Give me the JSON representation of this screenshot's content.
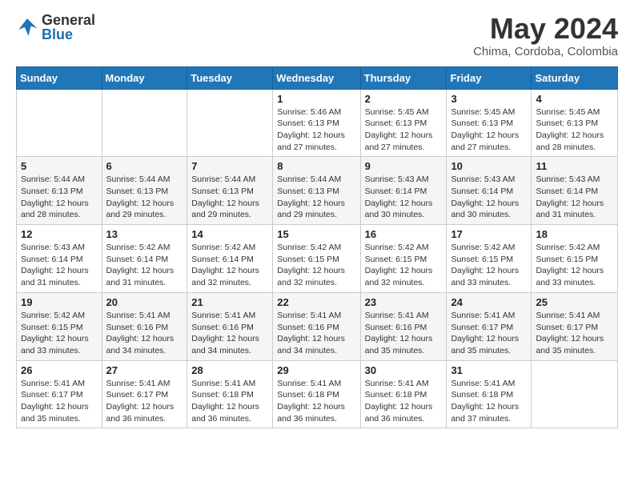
{
  "header": {
    "logo_general": "General",
    "logo_blue": "Blue",
    "month_title": "May 2024",
    "location": "Chima, Cordoba, Colombia"
  },
  "calendar": {
    "days_of_week": [
      "Sunday",
      "Monday",
      "Tuesday",
      "Wednesday",
      "Thursday",
      "Friday",
      "Saturday"
    ],
    "weeks": [
      [
        {
          "day": "",
          "info": ""
        },
        {
          "day": "",
          "info": ""
        },
        {
          "day": "",
          "info": ""
        },
        {
          "day": "1",
          "info": "Sunrise: 5:46 AM\nSunset: 6:13 PM\nDaylight: 12 hours and 27 minutes."
        },
        {
          "day": "2",
          "info": "Sunrise: 5:45 AM\nSunset: 6:13 PM\nDaylight: 12 hours and 27 minutes."
        },
        {
          "day": "3",
          "info": "Sunrise: 5:45 AM\nSunset: 6:13 PM\nDaylight: 12 hours and 27 minutes."
        },
        {
          "day": "4",
          "info": "Sunrise: 5:45 AM\nSunset: 6:13 PM\nDaylight: 12 hours and 28 minutes."
        }
      ],
      [
        {
          "day": "5",
          "info": "Sunrise: 5:44 AM\nSunset: 6:13 PM\nDaylight: 12 hours and 28 minutes."
        },
        {
          "day": "6",
          "info": "Sunrise: 5:44 AM\nSunset: 6:13 PM\nDaylight: 12 hours and 29 minutes."
        },
        {
          "day": "7",
          "info": "Sunrise: 5:44 AM\nSunset: 6:13 PM\nDaylight: 12 hours and 29 minutes."
        },
        {
          "day": "8",
          "info": "Sunrise: 5:44 AM\nSunset: 6:13 PM\nDaylight: 12 hours and 29 minutes."
        },
        {
          "day": "9",
          "info": "Sunrise: 5:43 AM\nSunset: 6:14 PM\nDaylight: 12 hours and 30 minutes."
        },
        {
          "day": "10",
          "info": "Sunrise: 5:43 AM\nSunset: 6:14 PM\nDaylight: 12 hours and 30 minutes."
        },
        {
          "day": "11",
          "info": "Sunrise: 5:43 AM\nSunset: 6:14 PM\nDaylight: 12 hours and 31 minutes."
        }
      ],
      [
        {
          "day": "12",
          "info": "Sunrise: 5:43 AM\nSunset: 6:14 PM\nDaylight: 12 hours and 31 minutes."
        },
        {
          "day": "13",
          "info": "Sunrise: 5:42 AM\nSunset: 6:14 PM\nDaylight: 12 hours and 31 minutes."
        },
        {
          "day": "14",
          "info": "Sunrise: 5:42 AM\nSunset: 6:14 PM\nDaylight: 12 hours and 32 minutes."
        },
        {
          "day": "15",
          "info": "Sunrise: 5:42 AM\nSunset: 6:15 PM\nDaylight: 12 hours and 32 minutes."
        },
        {
          "day": "16",
          "info": "Sunrise: 5:42 AM\nSunset: 6:15 PM\nDaylight: 12 hours and 32 minutes."
        },
        {
          "day": "17",
          "info": "Sunrise: 5:42 AM\nSunset: 6:15 PM\nDaylight: 12 hours and 33 minutes."
        },
        {
          "day": "18",
          "info": "Sunrise: 5:42 AM\nSunset: 6:15 PM\nDaylight: 12 hours and 33 minutes."
        }
      ],
      [
        {
          "day": "19",
          "info": "Sunrise: 5:42 AM\nSunset: 6:15 PM\nDaylight: 12 hours and 33 minutes."
        },
        {
          "day": "20",
          "info": "Sunrise: 5:41 AM\nSunset: 6:16 PM\nDaylight: 12 hours and 34 minutes."
        },
        {
          "day": "21",
          "info": "Sunrise: 5:41 AM\nSunset: 6:16 PM\nDaylight: 12 hours and 34 minutes."
        },
        {
          "day": "22",
          "info": "Sunrise: 5:41 AM\nSunset: 6:16 PM\nDaylight: 12 hours and 34 minutes."
        },
        {
          "day": "23",
          "info": "Sunrise: 5:41 AM\nSunset: 6:16 PM\nDaylight: 12 hours and 35 minutes."
        },
        {
          "day": "24",
          "info": "Sunrise: 5:41 AM\nSunset: 6:17 PM\nDaylight: 12 hours and 35 minutes."
        },
        {
          "day": "25",
          "info": "Sunrise: 5:41 AM\nSunset: 6:17 PM\nDaylight: 12 hours and 35 minutes."
        }
      ],
      [
        {
          "day": "26",
          "info": "Sunrise: 5:41 AM\nSunset: 6:17 PM\nDaylight: 12 hours and 35 minutes."
        },
        {
          "day": "27",
          "info": "Sunrise: 5:41 AM\nSunset: 6:17 PM\nDaylight: 12 hours and 36 minutes."
        },
        {
          "day": "28",
          "info": "Sunrise: 5:41 AM\nSunset: 6:18 PM\nDaylight: 12 hours and 36 minutes."
        },
        {
          "day": "29",
          "info": "Sunrise: 5:41 AM\nSunset: 6:18 PM\nDaylight: 12 hours and 36 minutes."
        },
        {
          "day": "30",
          "info": "Sunrise: 5:41 AM\nSunset: 6:18 PM\nDaylight: 12 hours and 36 minutes."
        },
        {
          "day": "31",
          "info": "Sunrise: 5:41 AM\nSunset: 6:18 PM\nDaylight: 12 hours and 37 minutes."
        },
        {
          "day": "",
          "info": ""
        }
      ]
    ]
  }
}
